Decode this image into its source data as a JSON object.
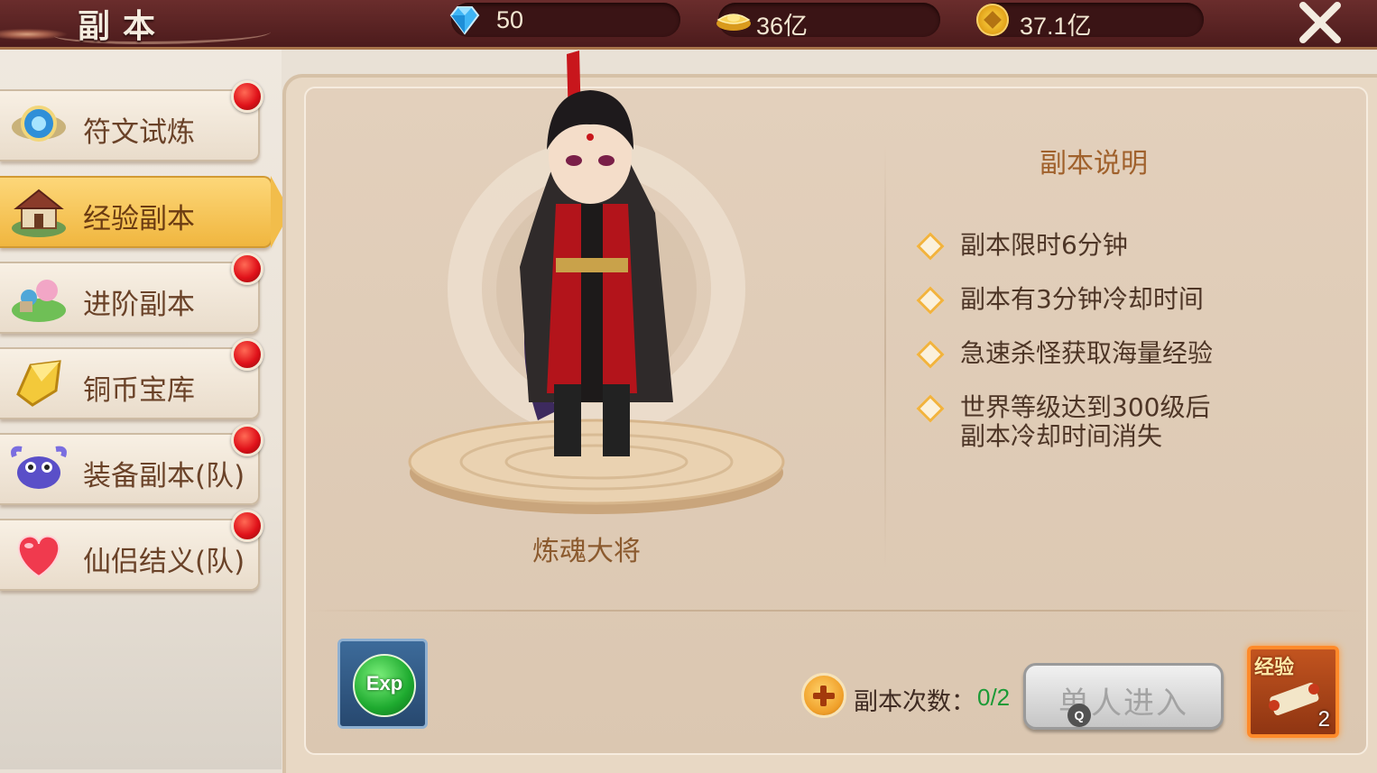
{
  "header": {
    "title": "副本",
    "resources": [
      {
        "icon": "diamond-icon",
        "value": "50"
      },
      {
        "icon": "gold-ingot-icon",
        "value": "36亿"
      },
      {
        "icon": "copper-coin-icon",
        "value": "37.1亿"
      }
    ],
    "close_icon": "close-icon"
  },
  "sidebar": {
    "items": [
      {
        "label": "符文试炼",
        "icon": "rune-orb-icon",
        "badge": true
      },
      {
        "label": "经验副本",
        "icon": "house-icon",
        "badge": false,
        "active": true
      },
      {
        "label": "进阶副本",
        "icon": "garden-icon",
        "badge": true
      },
      {
        "label": "铜币宝库",
        "icon": "gold-crystal-icon",
        "badge": true
      },
      {
        "label": "装备副本(队)",
        "icon": "crab-monster-icon",
        "badge": true
      },
      {
        "label": "仙侣结义(队)",
        "icon": "heart-icon",
        "badge": true
      }
    ]
  },
  "main": {
    "boss_name": "炼魂大将",
    "info_title": "副本说明",
    "rules": [
      "副本限时6分钟",
      "副本有3分钟冷却时间",
      "急速杀怪获取海量经验",
      "世界等级达到300级后副本冷却时间消失"
    ],
    "exp_label": "Exp",
    "count_label": "副本次数：",
    "count_value": "0/2",
    "enter_button": "单人进入",
    "hotkey": "Q",
    "reward": {
      "tag": "经验",
      "count": "2",
      "icon": "exp-scroll-icon"
    },
    "colors": {
      "accent": "#f2b33d",
      "count_green": "#1b9a36",
      "badge_red": "#e0121a"
    }
  }
}
